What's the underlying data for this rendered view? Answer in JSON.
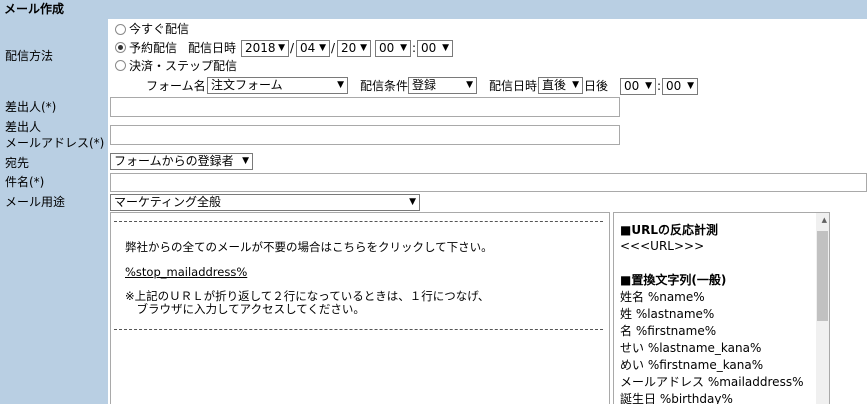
{
  "header": {
    "title": "メール作成"
  },
  "labels": {
    "delivery_method": "配信方法",
    "sender": "差出人(*)",
    "sender_email_line1": "差出人",
    "sender_email_line2": "メールアドレス(*)",
    "recipient": "宛先",
    "subject": "件名(*)",
    "mail_purpose": "メール用途"
  },
  "delivery": {
    "option_immediate": "今すぐ配信",
    "option_scheduled": "予約配信",
    "option_payment_step": "決済・ステップ配信",
    "selected_option": "予約配信",
    "datetime_label": "配信日時",
    "year": "2018",
    "month": "04",
    "day": "20",
    "hour": "00",
    "minute": "00",
    "sep_slash": "/",
    "sep_colon": ":",
    "form_name_label": "フォーム名",
    "form_name_value": "注文フォーム",
    "condition_label": "配信条件",
    "condition_value": "登録",
    "step_datetime_label": "配信日時",
    "step_timing_value": "直後",
    "days_after_label": "日後",
    "step_hour": "00",
    "step_minute": "00"
  },
  "fields": {
    "sender_value": "",
    "sender_email_value": "",
    "recipient_value": "フォームからの登録者",
    "subject_value": "",
    "mail_purpose_value": "マーケティング全般"
  },
  "body": {
    "line1": "弊社からの全てのメールが不要の場合はこちらをクリックして下さい。",
    "line2": "%stop_mailaddress%",
    "line3": "※上記のＵＲＬが折り返して２行になっているときは、１行につなげ、",
    "line4": "　ブラウザに入力してアクセスしてください。"
  },
  "reference_panel": {
    "url_tracking_heading": "■URLの反応計測",
    "url_tag": "<<<URL>>>",
    "replacement_heading": "■置換文字列(一般)",
    "items": [
      "姓名 %name%",
      "姓 %lastname%",
      "名 %firstname%",
      "せい %lastname_kana%",
      "めい %firstname_kana%",
      "メールアドレス %mailaddress%",
      "誕生日 %birthday%"
    ]
  },
  "dropdown_arrow": "▼",
  "scroll_up_arrow": "▲",
  "colors": {
    "label_background": "#b9cfe3"
  }
}
